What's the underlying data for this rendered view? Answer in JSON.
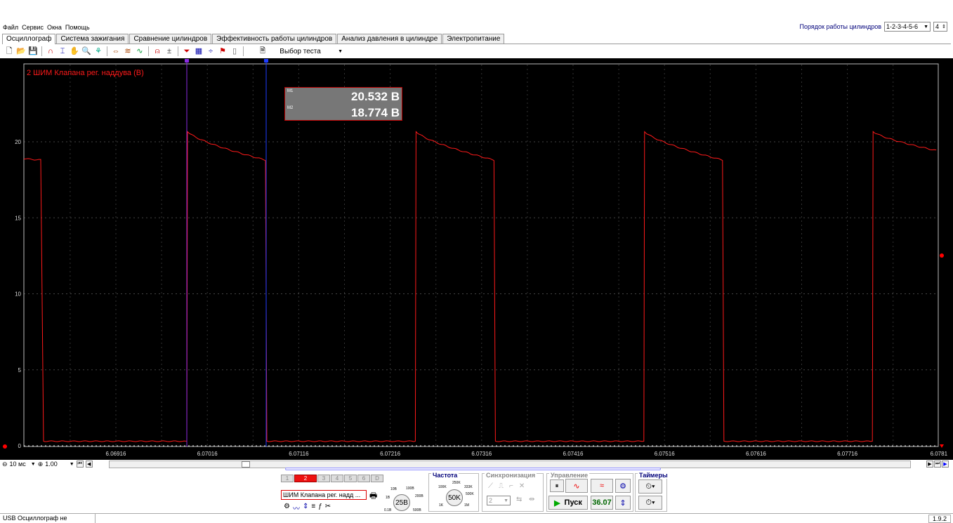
{
  "menu": [
    "Файл",
    "Сервис",
    "Окна",
    "Помощь"
  ],
  "cylinder_order": {
    "label": "Порядок работы цилиндров",
    "value": "1-2-3-4-5-6",
    "count": "4"
  },
  "tabs": [
    "Осциллограф",
    "Система зажигания",
    "Сравнение цилиндров",
    "Эффективность работы цилиндров",
    "Анализ давления в цилиндре",
    "Электропитание"
  ],
  "active_tab": 0,
  "toolbar": {
    "test_select": "Выбор теста"
  },
  "scope": {
    "channel_label": "2 ШИМ Клапана рег. наддува (В)",
    "y_ticks": [
      "20",
      "15",
      "10",
      "5",
      "0"
    ],
    "x_ticks": [
      "6.06916",
      "6.07016",
      "6.07116",
      "6.07216",
      "6.07316",
      "6.07416",
      "6.07516",
      "6.07616",
      "6.07716",
      "6.0781"
    ],
    "trace_color": "#ff1a1a",
    "m1_label": "M1",
    "m1_value": "20.532 В",
    "m2_label": "M2",
    "m2_value": "18.774 В"
  },
  "chart_data": {
    "type": "line",
    "ylim": [
      0,
      25
    ],
    "y_ticks": [
      0,
      5,
      10,
      15,
      20
    ],
    "waveform": "square PWM; high ≈ 20.7 В decaying to ≈ 18.8 В, low ≈ 0.3 В",
    "high_start": 20.7,
    "high_end": 18.8,
    "low": 0.3
  },
  "bottom": {
    "time_scale": "10 мс",
    "zoom": "1.00"
  },
  "panel": {
    "channels": [
      "1",
      "2",
      "3",
      "4",
      "5",
      "6",
      "D"
    ],
    "active_channel": "2",
    "channel_name": "ШИМ Клапана рег. надд ...",
    "range_value": "25В",
    "range_ticks": [
      "10В",
      "100В",
      "1В",
      "200В",
      "0.1В",
      "500В"
    ],
    "freq_title": "Частота",
    "freq_value": "50K",
    "freq_ticks": [
      "250K",
      "100K",
      "333K",
      "500K",
      "1K",
      "1M"
    ],
    "sync_title": "Синхронизация",
    "sync_value": "2",
    "control_title": "Управление",
    "start_label": "Пуск",
    "fps": "36.07",
    "timers_title": "Таймеры"
  },
  "status": {
    "text": "USB Осциллограф не подключен",
    "version": "1.9.2"
  }
}
